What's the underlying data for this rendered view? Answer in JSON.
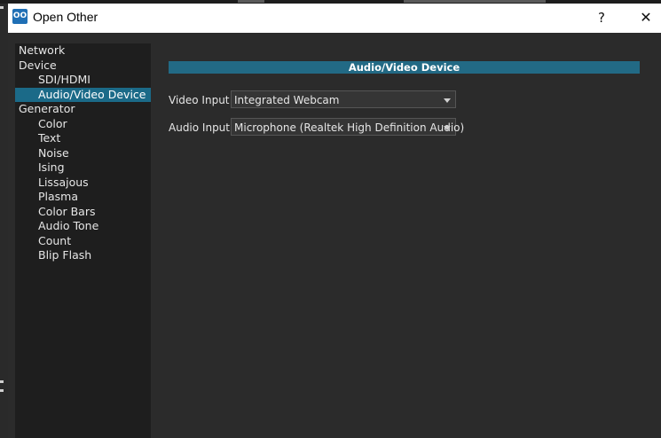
{
  "window": {
    "title": "Open Other",
    "help_label": "?",
    "close_label": "✕",
    "icon_glyph": "OO"
  },
  "nav": {
    "items": [
      {
        "label": "Network",
        "level": 0
      },
      {
        "label": "Device",
        "level": 0
      },
      {
        "label": "SDI/HDMI",
        "level": 1
      },
      {
        "label": "Audio/Video Device",
        "level": 1,
        "selected": true
      },
      {
        "label": "Generator",
        "level": 0
      },
      {
        "label": "Color",
        "level": 1
      },
      {
        "label": "Text",
        "level": 1
      },
      {
        "label": "Noise",
        "level": 1
      },
      {
        "label": "Ising",
        "level": 1
      },
      {
        "label": "Lissajous",
        "level": 1
      },
      {
        "label": "Plasma",
        "level": 1
      },
      {
        "label": "Color Bars",
        "level": 1
      },
      {
        "label": "Audio Tone",
        "level": 1
      },
      {
        "label": "Count",
        "level": 1
      },
      {
        "label": "Blip Flash",
        "level": 1
      }
    ]
  },
  "panel": {
    "header": "Audio/Video Device",
    "video_input": {
      "label": "Video Input",
      "value": "Integrated Webcam"
    },
    "audio_input": {
      "label": "Audio Input",
      "value": "Microphone (Realtek High Definition Audio)"
    }
  },
  "colors": {
    "accent": "#1b6a88",
    "header": "#226a85",
    "background": "#2b2b2b",
    "nav_background": "#1e1e1e"
  }
}
